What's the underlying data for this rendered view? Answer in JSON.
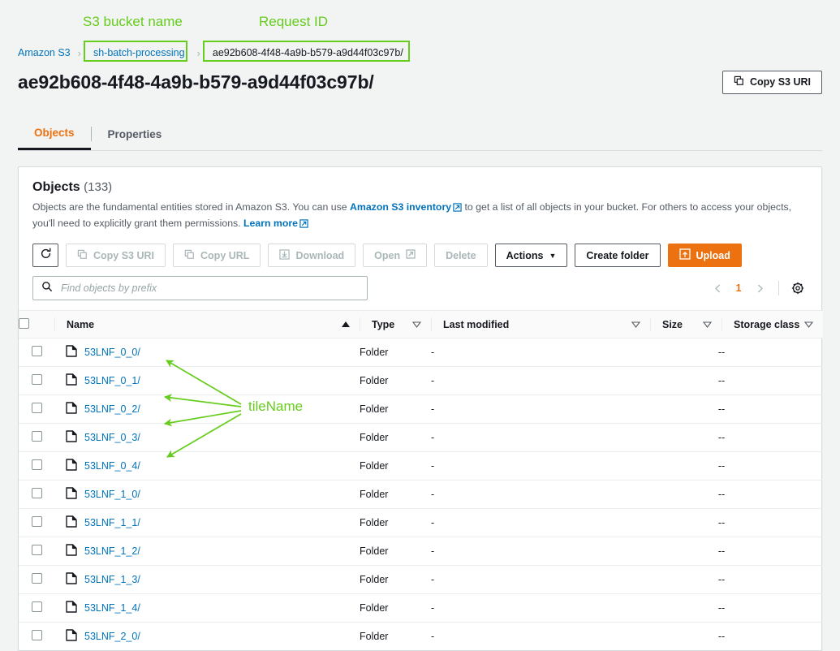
{
  "breadcrumb": {
    "root_label": "Amazon S3",
    "bucket_label": "sh-batch-processing",
    "current_label": "ae92b608-4f48-4a9b-b579-a9d44f03c97b/",
    "separator": "›"
  },
  "header": {
    "title": "ae92b608-4f48-4a9b-b579-a9d44f03c97b/",
    "copy_uri_label": "Copy S3 URI"
  },
  "tabs": [
    {
      "label": "Objects",
      "active": true
    },
    {
      "label": "Properties",
      "active": false
    }
  ],
  "objects_panel": {
    "title": "Objects",
    "count": "(133)",
    "description_part1": "Objects are the fundamental entities stored in Amazon S3. You can use ",
    "inventory_link": "Amazon S3 inventory",
    "description_part2": " to get a list of all objects in your bucket. For others to access your objects, you'll need to explicitly grant them permissions. ",
    "learn_more_link": "Learn more"
  },
  "toolbar": {
    "refresh_label": "Refresh",
    "copy_s3_uri_label": "Copy S3 URI",
    "copy_url_label": "Copy URL",
    "download_label": "Download",
    "open_label": "Open",
    "delete_label": "Delete",
    "actions_label": "Actions",
    "actions_caret": "▼",
    "create_folder_label": "Create folder",
    "upload_label": "Upload"
  },
  "search": {
    "placeholder": "Find objects by prefix",
    "value": ""
  },
  "pagination": {
    "prev": "‹",
    "page": "1",
    "next": "›"
  },
  "table": {
    "columns": [
      "Name",
      "Type",
      "Last modified",
      "Size",
      "Storage class"
    ],
    "sort_column": "Name",
    "sort_direction": "asc",
    "rows": [
      {
        "name": "53LNF_0_0/",
        "type": "Folder",
        "last_modified": "-",
        "size": "-",
        "storage_class": "-"
      },
      {
        "name": "53LNF_0_1/",
        "type": "Folder",
        "last_modified": "-",
        "size": "-",
        "storage_class": "-"
      },
      {
        "name": "53LNF_0_2/",
        "type": "Folder",
        "last_modified": "-",
        "size": "-",
        "storage_class": "-"
      },
      {
        "name": "53LNF_0_3/",
        "type": "Folder",
        "last_modified": "-",
        "size": "-",
        "storage_class": "-"
      },
      {
        "name": "53LNF_0_4/",
        "type": "Folder",
        "last_modified": "-",
        "size": "-",
        "storage_class": "-"
      },
      {
        "name": "53LNF_1_0/",
        "type": "Folder",
        "last_modified": "-",
        "size": "-",
        "storage_class": "-"
      },
      {
        "name": "53LNF_1_1/",
        "type": "Folder",
        "last_modified": "-",
        "size": "-",
        "storage_class": "-"
      },
      {
        "name": "53LNF_1_2/",
        "type": "Folder",
        "last_modified": "-",
        "size": "-",
        "storage_class": "-"
      },
      {
        "name": "53LNF_1_3/",
        "type": "Folder",
        "last_modified": "-",
        "size": "-",
        "storage_class": "-"
      },
      {
        "name": "53LNF_1_4/",
        "type": "Folder",
        "last_modified": "-",
        "size": "-",
        "storage_class": "-"
      },
      {
        "name": "53LNF_2_0/",
        "type": "Folder",
        "last_modified": "-",
        "size": "-",
        "storage_class": "-"
      }
    ]
  },
  "annotations": {
    "color": "#66cc1e",
    "bucket_callout": "S3 bucket name",
    "request_callout": "Request ID",
    "tilename_callout": "tileName"
  }
}
